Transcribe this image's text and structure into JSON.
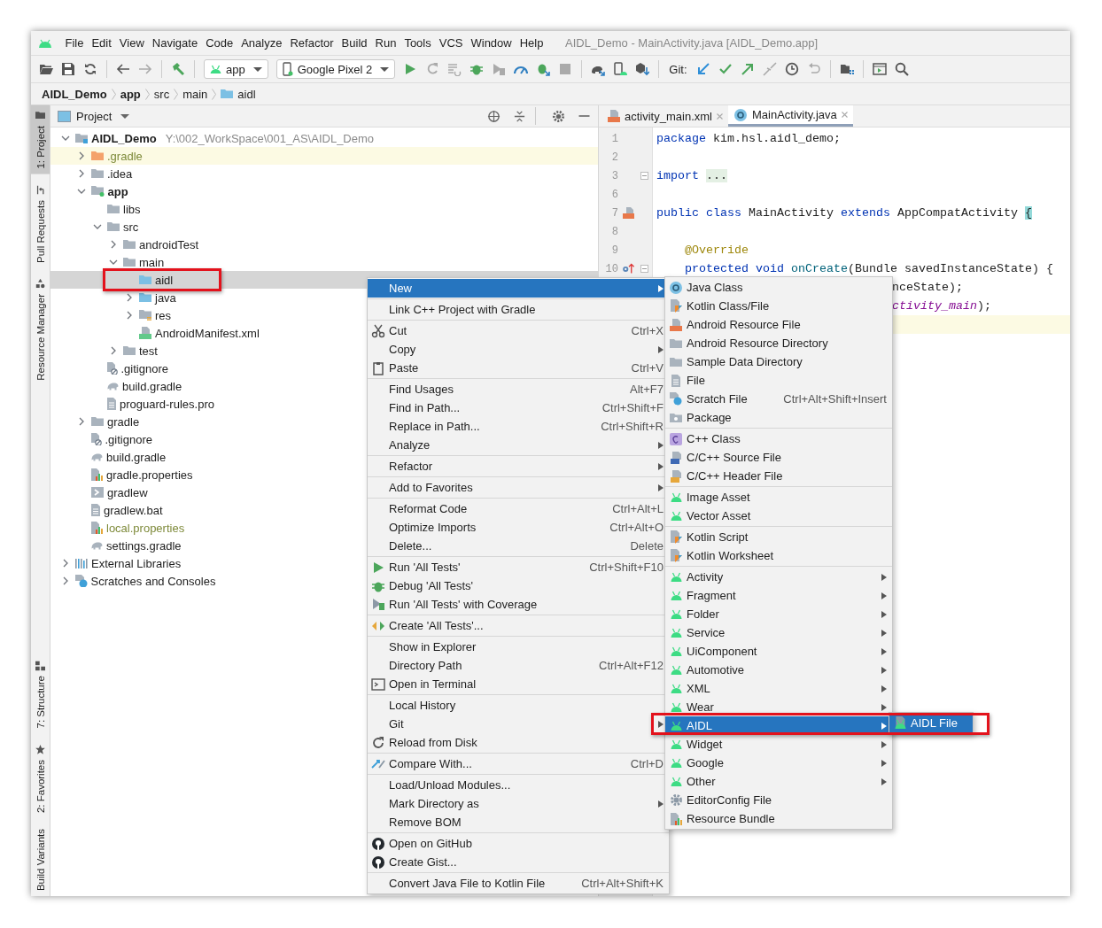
{
  "window": {
    "title": "AIDL_Demo - MainActivity.java [AIDL_Demo.app]"
  },
  "menu_bar": [
    "File",
    "Edit",
    "View",
    "Navigate",
    "Code",
    "Analyze",
    "Refactor",
    "Build",
    "Run",
    "Tools",
    "VCS",
    "Window",
    "Help"
  ],
  "toolbar": {
    "groups": [
      [
        {
          "kind": "open",
          "disabled": false
        },
        {
          "kind": "save",
          "disabled": false
        },
        {
          "kind": "sync",
          "disabled": false
        }
      ],
      [
        {
          "kind": "back",
          "disabled": false
        },
        {
          "kind": "forward",
          "disabled": true
        }
      ],
      [
        {
          "kind": "build",
          "disabled": false
        }
      ],
      [
        {
          "kind": "config",
          "label": "app",
          "disabled": false
        },
        {
          "kind": "device",
          "label": "Google Pixel 2",
          "disabled": false
        },
        {
          "kind": "run",
          "disabled": false
        },
        {
          "kind": "rerun",
          "disabled": true
        },
        {
          "kind": "apply",
          "disabled": true
        },
        {
          "kind": "debug",
          "disabled": false
        },
        {
          "kind": "coverage",
          "disabled": true
        },
        {
          "kind": "profile",
          "disabled": false
        },
        {
          "kind": "attach",
          "disabled": false
        },
        {
          "kind": "stop",
          "disabled": true
        }
      ],
      [
        {
          "kind": "gradle-sync",
          "disabled": false
        },
        {
          "kind": "avd",
          "disabled": false
        },
        {
          "kind": "sdk",
          "disabled": false
        }
      ],
      [
        {
          "kind": "git-label",
          "label": "Git:"
        },
        {
          "kind": "update",
          "disabled": false
        },
        {
          "kind": "commit",
          "disabled": false
        },
        {
          "kind": "push",
          "disabled": false
        },
        {
          "kind": "compare",
          "disabled": true
        },
        {
          "kind": "history",
          "disabled": false
        },
        {
          "kind": "rollback",
          "disabled": true
        }
      ],
      [
        {
          "kind": "structure",
          "disabled": false
        }
      ],
      [
        {
          "kind": "terminal",
          "disabled": false
        },
        {
          "kind": "search",
          "disabled": false
        }
      ]
    ]
  },
  "breadcrumbs": [
    {
      "label": "AIDL_Demo",
      "bold": true,
      "kind": "text"
    },
    {
      "label": "app",
      "bold": true,
      "kind": "text"
    },
    {
      "label": "src",
      "bold": false,
      "kind": "text"
    },
    {
      "label": "main",
      "bold": false,
      "kind": "text"
    },
    {
      "label": "aidl",
      "bold": false,
      "kind": "folder"
    }
  ],
  "left_strip": {
    "top": [
      {
        "label": "1: Project",
        "selected": true,
        "kind": "project"
      },
      {
        "label": "Pull Requests",
        "selected": false,
        "kind": "pull"
      },
      {
        "label": "Resource Manager",
        "selected": false,
        "kind": "resource"
      }
    ],
    "bottom": [
      {
        "label": "7: Structure",
        "selected": false,
        "kind": "structure"
      },
      {
        "label": "2: Favorites",
        "selected": false,
        "kind": "star"
      },
      {
        "label": "Build Variants",
        "selected": false,
        "kind": "variants"
      }
    ]
  },
  "project_panel": {
    "title": "Project",
    "tree": [
      {
        "label": "AIDL_Demo",
        "hint": "Y:\\002_WorkSpace\\001_AS\\AIDL_Demo",
        "kind": "module",
        "bold": true,
        "expanded": true,
        "selected": false,
        "ignored": false,
        "children": [
          {
            "label": ".gradle",
            "kind": "folder-orange",
            "bold": false,
            "expanded": false,
            "selected": false,
            "ignored": true
          },
          {
            "label": ".idea",
            "kind": "folder",
            "bold": false,
            "expanded": false,
            "selected": false,
            "ignored": false
          },
          {
            "label": "app",
            "kind": "folder-module",
            "bold": true,
            "expanded": true,
            "selected": false,
            "ignored": false,
            "children": [
              {
                "label": "libs",
                "kind": "folder",
                "bold": false,
                "selected": false,
                "ignored": false
              },
              {
                "label": "src",
                "kind": "folder",
                "bold": false,
                "expanded": true,
                "selected": false,
                "ignored": false,
                "children": [
                  {
                    "label": "androidTest",
                    "kind": "folder",
                    "bold": false,
                    "expanded": false,
                    "selected": false,
                    "ignored": false
                  },
                  {
                    "label": "main",
                    "kind": "folder",
                    "bold": false,
                    "expanded": true,
                    "selected": false,
                    "ignored": false,
                    "children": [
                      {
                        "label": "aidl",
                        "kind": "folder-blue",
                        "bold": false,
                        "selected": true,
                        "ignored": false
                      },
                      {
                        "label": "java",
                        "kind": "folder-blue",
                        "bold": false,
                        "expanded": false,
                        "selected": false,
                        "ignored": false
                      },
                      {
                        "label": "res",
                        "kind": "folder-res",
                        "bold": false,
                        "expanded": false,
                        "selected": false,
                        "ignored": false
                      },
                      {
                        "label": "AndroidManifest.xml",
                        "kind": "manifest",
                        "bold": false,
                        "selected": false,
                        "ignored": false
                      }
                    ]
                  },
                  {
                    "label": "test",
                    "kind": "folder",
                    "bold": false,
                    "expanded": false,
                    "selected": false,
                    "ignored": false
                  }
                ]
              },
              {
                "label": ".gitignore",
                "kind": "gitignore",
                "bold": false,
                "selected": false,
                "ignored": false
              },
              {
                "label": "build.gradle",
                "kind": "gradle",
                "bold": false,
                "selected": false,
                "ignored": false
              },
              {
                "label": "proguard-rules.pro",
                "kind": "text",
                "bold": false,
                "selected": false,
                "ignored": false
              }
            ]
          },
          {
            "label": "gradle",
            "kind": "folder",
            "bold": false,
            "expanded": false,
            "selected": false,
            "ignored": false
          },
          {
            "label": ".gitignore",
            "kind": "gitignore",
            "bold": false,
            "selected": false,
            "ignored": false
          },
          {
            "label": "build.gradle",
            "kind": "gradle",
            "bold": false,
            "selected": false,
            "ignored": false
          },
          {
            "label": "gradle.properties",
            "kind": "properties",
            "bold": false,
            "selected": false,
            "ignored": false
          },
          {
            "label": "gradlew",
            "kind": "script",
            "bold": false,
            "selected": false,
            "ignored": false
          },
          {
            "label": "gradlew.bat",
            "kind": "text",
            "bold": false,
            "selected": false,
            "ignored": false
          },
          {
            "label": "local.properties",
            "kind": "properties",
            "bold": false,
            "selected": false,
            "ignored": true
          },
          {
            "label": "settings.gradle",
            "kind": "gradle",
            "bold": false,
            "selected": false,
            "ignored": false
          }
        ]
      },
      {
        "label": "External Libraries",
        "kind": "libraries",
        "bold": false,
        "expanded": false,
        "selected": false,
        "ignored": false
      },
      {
        "label": "Scratches and Consoles",
        "kind": "scratches",
        "bold": false,
        "expanded": false,
        "selected": false,
        "ignored": false
      }
    ]
  },
  "editor": {
    "tabs": [
      {
        "label": "activity_main.xml",
        "kind": "xml",
        "selected": false
      },
      {
        "label": "MainActivity.java",
        "kind": "class",
        "selected": true
      }
    ],
    "lines": [
      {
        "number": "1",
        "kind": "plain",
        "fold": false,
        "tokens": [
          {
            "t": "package",
            "kind": "kw"
          },
          {
            "t": " kim.hsl.aidl_demo;",
            "kind": "plain"
          }
        ]
      },
      {
        "number": "2",
        "kind": "plain",
        "fold": false
      },
      {
        "number": "3",
        "kind": "plain",
        "fold": true,
        "tokens": [
          {
            "t": "import ",
            "kind": "kw"
          },
          {
            "t": "...",
            "kind": "folded"
          }
        ]
      },
      {
        "number": "6",
        "kind": "plain",
        "fold": false
      },
      {
        "number": "7",
        "kind": "layout",
        "fold": false,
        "tokens": [
          {
            "t": "public class",
            "kind": "kw"
          },
          {
            "t": " MainActivity ",
            "kind": "plain"
          },
          {
            "t": "extends",
            "kind": "kw"
          },
          {
            "t": " AppCompatActivity ",
            "kind": "plain"
          },
          {
            "t": "{",
            "kind": "brace"
          }
        ]
      },
      {
        "number": "8",
        "kind": "plain",
        "fold": false
      },
      {
        "number": "9",
        "kind": "plain",
        "fold": false,
        "tokens": [
          {
            "t": "    @Override",
            "kind": "annotation"
          }
        ]
      },
      {
        "number": "10",
        "kind": "override",
        "fold": true,
        "tokens": [
          {
            "t": "    protected void ",
            "kind": "kw"
          },
          {
            "t": "onCreate",
            "kind": "method"
          },
          {
            "t": "(Bundle savedInstanceState) {",
            "kind": "plain"
          }
        ]
      },
      {
        "kind": "partial",
        "current": false,
        "tokens": [
          {
            "t": "nceState);",
            "kind": "plain"
          }
        ]
      },
      {
        "kind": "partial",
        "current": false,
        "tokens": [
          {
            "t": "ctivity_main",
            "kind": "field"
          },
          {
            "t": ");",
            "kind": "plain"
          }
        ]
      },
      {
        "kind": "partial",
        "current": true
      }
    ]
  },
  "context_menu": {
    "groups": [
      [
        {
          "label": "New",
          "kind": "plain",
          "submenu": true,
          "selected": true
        }
      ],
      [
        {
          "label": "Link C++ Project with Gradle",
          "kind": "plain",
          "submenu": false,
          "selected": false
        }
      ],
      [
        {
          "label": "Cut",
          "shortcut": "Ctrl+X",
          "kind": "cut",
          "submenu": false,
          "selected": false
        },
        {
          "label": "Copy",
          "kind": "plain",
          "submenu": true,
          "selected": false
        },
        {
          "label": "Paste",
          "shortcut": "Ctrl+V",
          "kind": "paste",
          "submenu": false,
          "selected": false
        }
      ],
      [
        {
          "label": "Find Usages",
          "shortcut": "Alt+F7",
          "kind": "plain",
          "submenu": false,
          "selected": false
        },
        {
          "label": "Find in Path...",
          "shortcut": "Ctrl+Shift+F",
          "kind": "plain",
          "submenu": false,
          "selected": false
        },
        {
          "label": "Replace in Path...",
          "shortcut": "Ctrl+Shift+R",
          "kind": "plain",
          "submenu": false,
          "selected": false
        },
        {
          "label": "Analyze",
          "kind": "plain",
          "submenu": true,
          "selected": false
        }
      ],
      [
        {
          "label": "Refactor",
          "kind": "plain",
          "submenu": true,
          "selected": false
        }
      ],
      [
        {
          "label": "Add to Favorites",
          "kind": "plain",
          "submenu": true,
          "selected": false
        }
      ],
      [
        {
          "label": "Reformat Code",
          "shortcut": "Ctrl+Alt+L",
          "kind": "plain",
          "submenu": false,
          "selected": false
        },
        {
          "label": "Optimize Imports",
          "shortcut": "Ctrl+Alt+O",
          "kind": "plain",
          "submenu": false,
          "selected": false
        },
        {
          "label": "Delete...",
          "shortcut": "Delete",
          "kind": "plain",
          "submenu": false,
          "selected": false
        }
      ],
      [
        {
          "label": "Run 'All Tests'",
          "shortcut": "Ctrl+Shift+F10",
          "kind": "run",
          "submenu": false,
          "selected": false
        },
        {
          "label": "Debug 'All Tests'",
          "kind": "debug",
          "submenu": false,
          "selected": false
        },
        {
          "label": "Run 'All Tests' with Coverage",
          "kind": "coverage",
          "submenu": false,
          "selected": false
        }
      ],
      [
        {
          "label": "Create 'All Tests'...",
          "kind": "create-test",
          "submenu": false,
          "selected": false
        }
      ],
      [
        {
          "label": "Show in Explorer",
          "kind": "plain",
          "submenu": false,
          "selected": false
        },
        {
          "label": "Directory Path",
          "shortcut": "Ctrl+Alt+F12",
          "kind": "plain",
          "submenu": false,
          "selected": false
        },
        {
          "label": "Open in Terminal",
          "kind": "terminal",
          "submenu": false,
          "selected": false
        }
      ],
      [
        {
          "label": "Local History",
          "kind": "plain",
          "submenu": false,
          "selected": false
        },
        {
          "label": "Git",
          "kind": "plain",
          "submenu": true,
          "selected": false
        },
        {
          "label": "Reload from Disk",
          "kind": "reload",
          "submenu": false,
          "selected": false
        }
      ],
      [
        {
          "label": "Compare With...",
          "shortcut": "Ctrl+D",
          "kind": "compare",
          "submenu": false,
          "selected": false
        }
      ],
      [
        {
          "label": "Load/Unload Modules...",
          "kind": "plain",
          "submenu": false,
          "selected": false
        },
        {
          "label": "Mark Directory as",
          "kind": "plain",
          "submenu": true,
          "selected": false
        },
        {
          "label": "Remove BOM",
          "kind": "plain",
          "submenu": false,
          "selected": false
        }
      ],
      [
        {
          "label": "Open on GitHub",
          "kind": "github",
          "submenu": false,
          "selected": false
        },
        {
          "label": "Create Gist...",
          "kind": "github",
          "submenu": false,
          "selected": false
        }
      ],
      [
        {
          "label": "Convert Java File to Kotlin File",
          "shortcut": "Ctrl+Alt+Shift+K",
          "kind": "plain",
          "submenu": false,
          "selected": false
        }
      ]
    ]
  },
  "new_submenu": {
    "groups": [
      [
        {
          "label": "Java Class",
          "kind": "class",
          "submenu": false,
          "selected": false
        },
        {
          "label": "Kotlin Class/File",
          "kind": "kotlin-file",
          "submenu": false,
          "selected": false
        },
        {
          "label": "Android Resource File",
          "kind": "xml",
          "submenu": false,
          "selected": false
        },
        {
          "label": "Android Resource Directory",
          "kind": "folder",
          "submenu": false,
          "selected": false
        },
        {
          "label": "Sample Data Directory",
          "kind": "folder",
          "submenu": false,
          "selected": false
        },
        {
          "label": "File",
          "kind": "file",
          "submenu": false,
          "selected": false
        },
        {
          "label": "Scratch File",
          "shortcut": "Ctrl+Alt+Shift+Insert",
          "kind": "scratches",
          "submenu": false,
          "selected": false
        },
        {
          "label": "Package",
          "kind": "package",
          "submenu": false,
          "selected": false
        }
      ],
      [
        {
          "label": "C++ Class",
          "kind": "cpp-class",
          "submenu": false,
          "selected": false
        },
        {
          "label": "C/C++ Source File",
          "kind": "cpp-file",
          "submenu": false,
          "selected": false
        },
        {
          "label": "C/C++ Header File",
          "kind": "header-file",
          "submenu": false,
          "selected": false
        }
      ],
      [
        {
          "label": "Image Asset",
          "kind": "android",
          "submenu": false,
          "selected": false
        },
        {
          "label": "Vector Asset",
          "kind": "android",
          "submenu": false,
          "selected": false
        }
      ],
      [
        {
          "label": "Kotlin Script",
          "kind": "kotlin-file",
          "submenu": false,
          "selected": false
        },
        {
          "label": "Kotlin Worksheet",
          "kind": "kotlin-file",
          "submenu": false,
          "selected": false
        }
      ],
      [
        {
          "label": "Activity",
          "kind": "android",
          "submenu": true,
          "selected": false
        },
        {
          "label": "Fragment",
          "kind": "android",
          "submenu": true,
          "selected": false
        },
        {
          "label": "Folder",
          "kind": "android",
          "submenu": true,
          "selected": false
        },
        {
          "label": "Service",
          "kind": "android",
          "submenu": true,
          "selected": false
        },
        {
          "label": "UiComponent",
          "kind": "android",
          "submenu": true,
          "selected": false
        },
        {
          "label": "Automotive",
          "kind": "android",
          "submenu": true,
          "selected": false
        },
        {
          "label": "XML",
          "kind": "android",
          "submenu": true,
          "selected": false
        },
        {
          "label": "Wear",
          "kind": "android",
          "submenu": true,
          "selected": false
        },
        {
          "label": "AIDL",
          "kind": "android",
          "submenu": true,
          "selected": true
        },
        {
          "label": "Widget",
          "kind": "android",
          "submenu": true,
          "selected": false
        },
        {
          "label": "Google",
          "kind": "android",
          "submenu": true,
          "selected": false
        },
        {
          "label": "Other",
          "kind": "android",
          "submenu": true,
          "selected": false
        },
        {
          "label": "EditorConfig File",
          "kind": "gear",
          "submenu": false,
          "selected": false
        },
        {
          "label": "Resource Bundle",
          "kind": "properties",
          "submenu": false,
          "selected": false
        }
      ]
    ]
  },
  "aidl_submenu": {
    "items": [
      {
        "label": "AIDL File",
        "kind": "android-file",
        "selected": true
      }
    ]
  }
}
